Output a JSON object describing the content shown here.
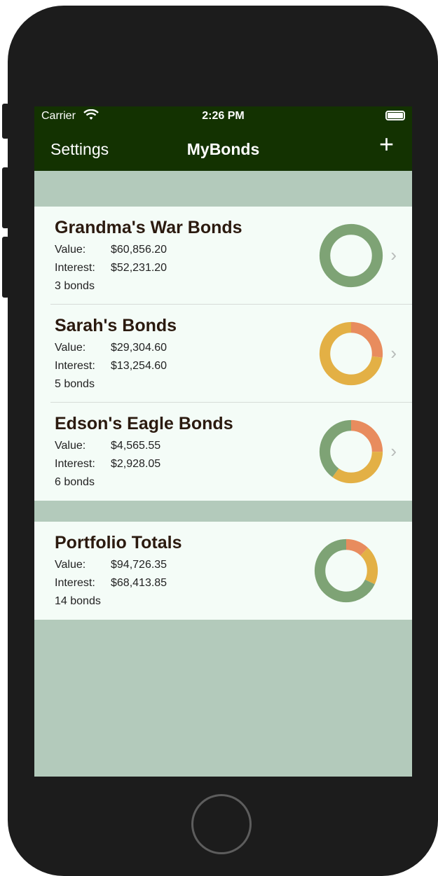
{
  "status_bar": {
    "carrier": "Carrier",
    "time": "2:26 PM"
  },
  "nav": {
    "left_label": "Settings",
    "title": "MyBonds",
    "add_label": "+"
  },
  "colors": {
    "green": "#7ea375",
    "orange": "#e88c5e",
    "yellow": "#e3b045",
    "bar": "#133201",
    "bg": "#b3cabb"
  },
  "labels": {
    "value": "Value:",
    "interest": "Interest:"
  },
  "portfolios": [
    {
      "name": "Grandma's War Bonds",
      "value": "$60,856.20",
      "interest": "$52,231.20",
      "count": "3 bonds",
      "segments": [
        {
          "color": "green",
          "fraction": 1.0
        }
      ]
    },
    {
      "name": "Sarah's Bonds",
      "value": "$29,304.60",
      "interest": "$13,254.60",
      "count": "5 bonds",
      "segments": [
        {
          "color": "orange",
          "fraction": 0.27
        },
        {
          "color": "yellow",
          "fraction": 0.73
        }
      ]
    },
    {
      "name": "Edson's Eagle Bonds",
      "value": "$4,565.55",
      "interest": "$2,928.05",
      "count": "6 bonds",
      "segments": [
        {
          "color": "orange",
          "fraction": 0.25
        },
        {
          "color": "yellow",
          "fraction": 0.35
        },
        {
          "color": "green",
          "fraction": 0.4
        }
      ]
    }
  ],
  "totals": {
    "name": "Portfolio Totals",
    "value": "$94,726.35",
    "interest": "$68,413.85",
    "count": "14 bonds",
    "segments": [
      {
        "color": "orange",
        "fraction": 0.12
      },
      {
        "color": "yellow",
        "fraction": 0.2
      },
      {
        "color": "green",
        "fraction": 0.68
      }
    ]
  }
}
